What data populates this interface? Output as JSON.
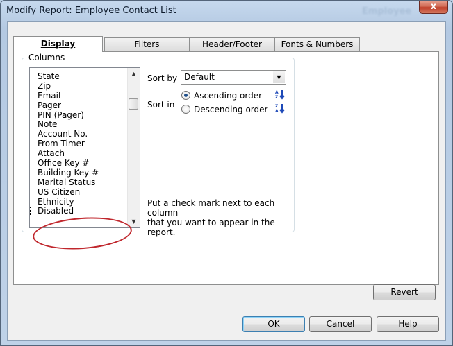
{
  "window": {
    "title": "Modify Report: Employee Contact List",
    "title_ghost": "Employee",
    "close_symbol": "x"
  },
  "tabs": [
    {
      "label": "Display",
      "active": true
    },
    {
      "label": "Filters",
      "active": false
    },
    {
      "label": "Header/Footer",
      "active": false
    },
    {
      "label": "Fonts & Numbers",
      "active": false
    }
  ],
  "columns_group": {
    "label": "Columns",
    "items": [
      "State",
      "Zip",
      "Email",
      "Pager",
      "PIN (Pager)",
      "Note",
      "Account No.",
      "From Timer",
      "Attach",
      "Office Key #",
      "Building Key #",
      "Marital Status",
      "US Citizen",
      "Ethnicity",
      "Disabled"
    ]
  },
  "sort": {
    "sort_by_label": "Sort by",
    "sort_by_value": "Default",
    "sort_in_label": "Sort in",
    "ascending_label": "Ascending order",
    "descending_label": "Descending order",
    "selected": "ascending",
    "ascending_icon": "sort-ascending-icon",
    "descending_icon": "sort-descending-icon"
  },
  "hint": {
    "line1": "Put a check mark next to each column",
    "line2": "that you want to appear in the report."
  },
  "buttons": {
    "revert": "Revert",
    "ok": "OK",
    "cancel": "Cancel",
    "help": "Help"
  },
  "colors": {
    "annotation_circle": "#c0272d",
    "close_button": "#c1402b"
  }
}
